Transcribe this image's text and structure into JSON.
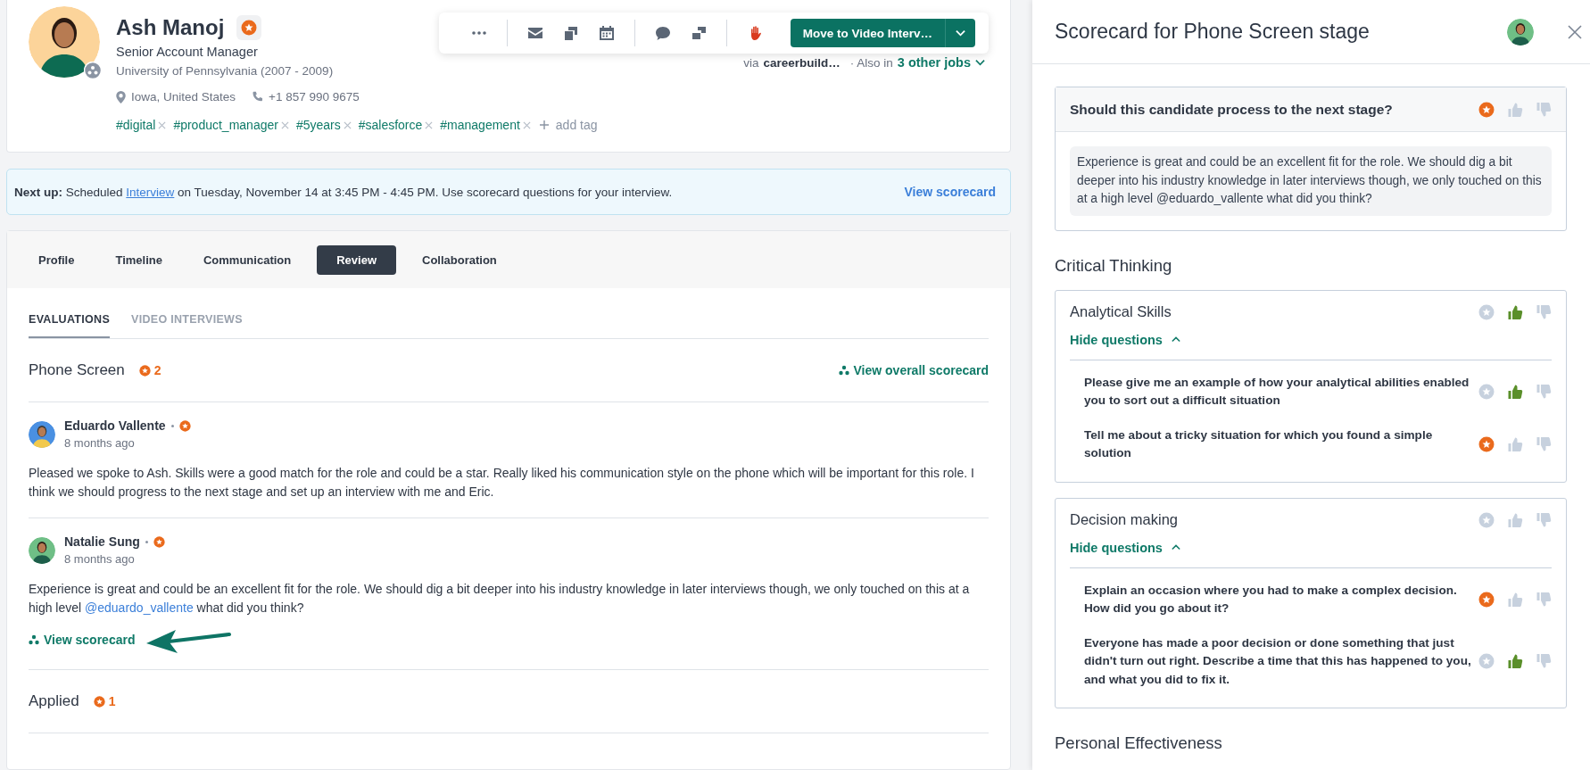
{
  "candidate": {
    "name": "Ash Manoj",
    "title": "Senior Account Manager",
    "education": "University of Pennsylvania (2007 - 2009)",
    "location": "Iowa, United States",
    "phone": "+1 857 990 9675",
    "tags": [
      "#digital",
      "#product_manager",
      "#5years",
      "#salesforce",
      "#management"
    ],
    "add_tag": "add tag",
    "source": {
      "prefix": "via",
      "site": "careerbuild…",
      "also": "· Also in",
      "jobs_link": "3 other jobs"
    }
  },
  "toolbar": {
    "primary_action": "Move to Video Interv…"
  },
  "next_up": {
    "text_before": "**Next up:** Scheduled ",
    "link": "Interview",
    "text_after": " on Tuesday, November 14 at 3:45 PM - 4:45 PM. Use scorecard questions for your interview.",
    "action": "View scorecard"
  },
  "tabs": [
    {
      "label": "Profile",
      "selected": false
    },
    {
      "label": "Timeline",
      "selected": false
    },
    {
      "label": "Communication",
      "selected": false
    },
    {
      "label": "Review",
      "selected": true
    },
    {
      "label": "Collaboration",
      "selected": false
    }
  ],
  "subtabs": [
    {
      "label": "EVALUATIONS",
      "selected": true
    },
    {
      "label": "VIDEO INTERVIEWS",
      "selected": false
    }
  ],
  "sections": [
    {
      "title": "Phone Screen",
      "count": "2",
      "action": "View overall scorecard",
      "evaluations": [
        {
          "name": "Eduardo Vallente",
          "time": "8 months ago",
          "comment": {
            "before": "Pleased we spoke to Ash. Skills were a good match for the role and could be a star. Really liked his communication style on the phone which will be important for this role. I think we should progress to the next stage and set up an interview with me and Eric."
          }
        },
        {
          "name": "Natalie Sung",
          "time": "8 months ago",
          "comment": {
            "before": "Experience is great and could be an excellent fit for the role. We should dig a bit deeper into his industry knowledge in later interviews though, we only touched on this at a high level ",
            "mention": "@eduardo_vallente",
            "after": " what did you think?"
          },
          "action": "View scorecard"
        }
      ]
    },
    {
      "title": "Applied",
      "count": "1"
    }
  ],
  "scorecard": {
    "title": "Scorecard for Phone Screen stage",
    "overall": {
      "question": "Should this candidate process to the next stage?",
      "star": true,
      "thumbs_up": false,
      "thumbs_down": false,
      "comment": "Experience is great and could be an excellent fit for the role. We should dig a bit deeper into his industry knowledge in later interviews though, we only touched on this at a high level @eduardo_vallente what did you think?"
    },
    "groups": [
      {
        "title": "Critical Thinking",
        "skills": [
          {
            "name": "Analytical Skills",
            "star": false,
            "thumbs_up": true,
            "thumbs_down": false,
            "toggle": "Hide questions",
            "expanded": true,
            "questions": [
              {
                "text": "Please give me an example of how your analytical abilities enabled you to sort out a difficult situation",
                "star": false,
                "thumbs_up": true,
                "thumbs_down": false
              },
              {
                "text": "Tell me about a tricky situation for which you found a simple solution",
                "star": true,
                "thumbs_up": false,
                "thumbs_down": false
              }
            ]
          },
          {
            "name": "Decision making",
            "star": false,
            "thumbs_up": false,
            "thumbs_down": false,
            "toggle": "Hide questions",
            "expanded": true,
            "questions": [
              {
                "text": "Explain an occasion where you had to make a complex decision. How did you go about it?",
                "star": true,
                "thumbs_up": false,
                "thumbs_down": false
              },
              {
                "text": "Everyone has made a poor decision or done something that just didn't turn out right. Describe a time that this has happened to you, and what you did to fix it.",
                "star": false,
                "thumbs_up": true,
                "thumbs_down": false
              }
            ]
          }
        ]
      },
      {
        "title": "Personal Effectiveness"
      }
    ]
  }
}
